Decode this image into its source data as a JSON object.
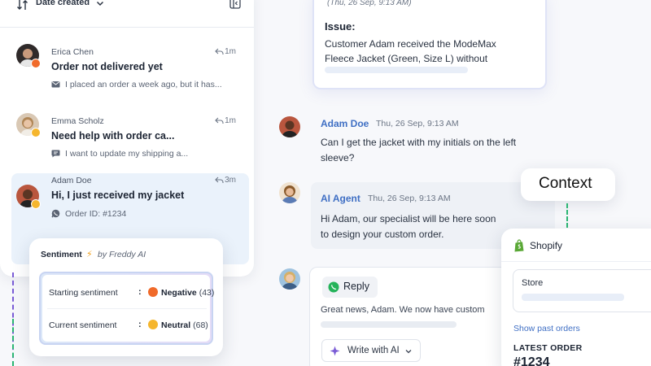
{
  "list": {
    "sort_label": "Date created",
    "conversations": [
      {
        "name": "Erica Chen",
        "time": "1m",
        "subject": "Order not delivered yet",
        "preview": "I placed an order a week ago, but it has...",
        "channel": "email-icon",
        "sentiment": "negative"
      },
      {
        "name": "Emma Scholz",
        "time": "1m",
        "subject": "Need help with order ca...",
        "preview": "I want to update my shipping a...",
        "channel": "chat-icon",
        "sentiment": "neutral"
      },
      {
        "name": "Adam Doe",
        "time": "3m",
        "subject": "Hi, I just received my jacket",
        "preview": "Order ID: #1234",
        "channel": "whatsapp-icon",
        "sentiment": "neutral"
      }
    ]
  },
  "sentiment": {
    "title": "Sentiment",
    "by": "by Freddy AI",
    "starting_label": "Starting sentiment",
    "starting_value": "Negative",
    "starting_count": "(43)",
    "current_label": "Current sentiment",
    "current_value": "Neutral",
    "current_count": "(68)",
    "colors": {
      "negative": "#f06a2a",
      "neutral": "#f5b62e"
    }
  },
  "thread": {
    "issue": {
      "time": "(Thu, 26 Sep, 9:13 AM)",
      "title": "Issue:",
      "body": "Customer Adam received the ModeMax Fleece Jacket (Green, Size L) without"
    },
    "customer_message": {
      "author": "Adam Doe",
      "time": "Thu, 26 Sep, 9:13 AM",
      "line1": "Can I get the jacket with my initials on the left",
      "line2": "sleeve?"
    },
    "agent_message": {
      "author": "AI Agent",
      "time": "Thu, 26 Sep, 9:13 AM",
      "line1": "Hi Adam, our specialist will be here soon",
      "line2": "to design your custom order."
    },
    "reply": {
      "channel_label": "Reply",
      "draft": "Great news, Adam. We now have custom",
      "write_ai_label": "Write with AI"
    }
  },
  "context": {
    "label": "Context",
    "shopify": {
      "title": "Shopify",
      "store_label": "Store",
      "past_orders_link": "Show past orders",
      "latest_order_label": "LATEST ORDER",
      "latest_order_number": "#1234"
    }
  },
  "colors": {
    "link_blue": "#3f6fc4",
    "whatsapp_green": "#25b35a",
    "selected_row": "#eaf2fb",
    "ai_purple": "#7a5cd6"
  }
}
